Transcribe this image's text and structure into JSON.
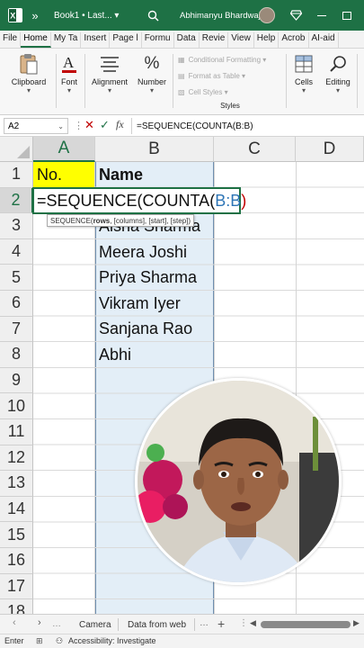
{
  "titlebar": {
    "chevron": "»",
    "doc_title": "Book1 • Last... ▾",
    "user_name": "Abhimanyu Bhardwaj",
    "brand_color": "#1e7145"
  },
  "tabs": [
    {
      "label": "File"
    },
    {
      "label": "Home"
    },
    {
      "label": "My Ta"
    },
    {
      "label": "Insert"
    },
    {
      "label": "Page l"
    },
    {
      "label": "Formu"
    },
    {
      "label": "Data"
    },
    {
      "label": "Revie"
    },
    {
      "label": "View"
    },
    {
      "label": "Help"
    },
    {
      "label": "Acrob"
    },
    {
      "label": "AI-aid"
    }
  ],
  "ribbon": {
    "clipboard": "Clipboard",
    "font": "Font",
    "alignment": "Alignment",
    "number": "Number",
    "conditional_formatting": "Conditional Formatting ▾",
    "format_as_table": "Format as Table ▾",
    "cell_styles": "Cell Styles ▾",
    "styles": "Styles",
    "cells": "Cells",
    "editing": "Editing"
  },
  "formula_bar": {
    "name_box": "A2",
    "fx": "fx",
    "formula": "=SEQUENCE(COUNTA(B:B)"
  },
  "grid": {
    "columns": [
      "A",
      "B",
      "C",
      "D"
    ],
    "rows": [
      "1",
      "2",
      "3",
      "4",
      "5",
      "6",
      "7",
      "8",
      "9",
      "10",
      "11",
      "12",
      "13",
      "14",
      "15",
      "16",
      "17",
      "18"
    ],
    "a1": "No.",
    "b1": "Name",
    "a2_formula_prefix": "=SEQUENCE(COUNTA(",
    "a2_formula_ref": "B:B",
    "a2_formula_close": ")",
    "tooltip_fn": "SEQUENCE(",
    "tooltip_arg": "rows",
    "tooltip_rest": ", [columns], [start], [step])",
    "names": [
      "Aisha Sharma",
      "Meera Joshi",
      "Priya Sharma",
      "Vikram Iyer",
      "Sanjana Rao",
      "Abhi"
    ],
    "header_fill": "#ffff00",
    "column_b_fill": "#e3eef7"
  },
  "sheets": [
    "Camera",
    "Data from web"
  ],
  "status": {
    "mode": "Enter",
    "accessibility": "Accessibility: Investigate"
  }
}
